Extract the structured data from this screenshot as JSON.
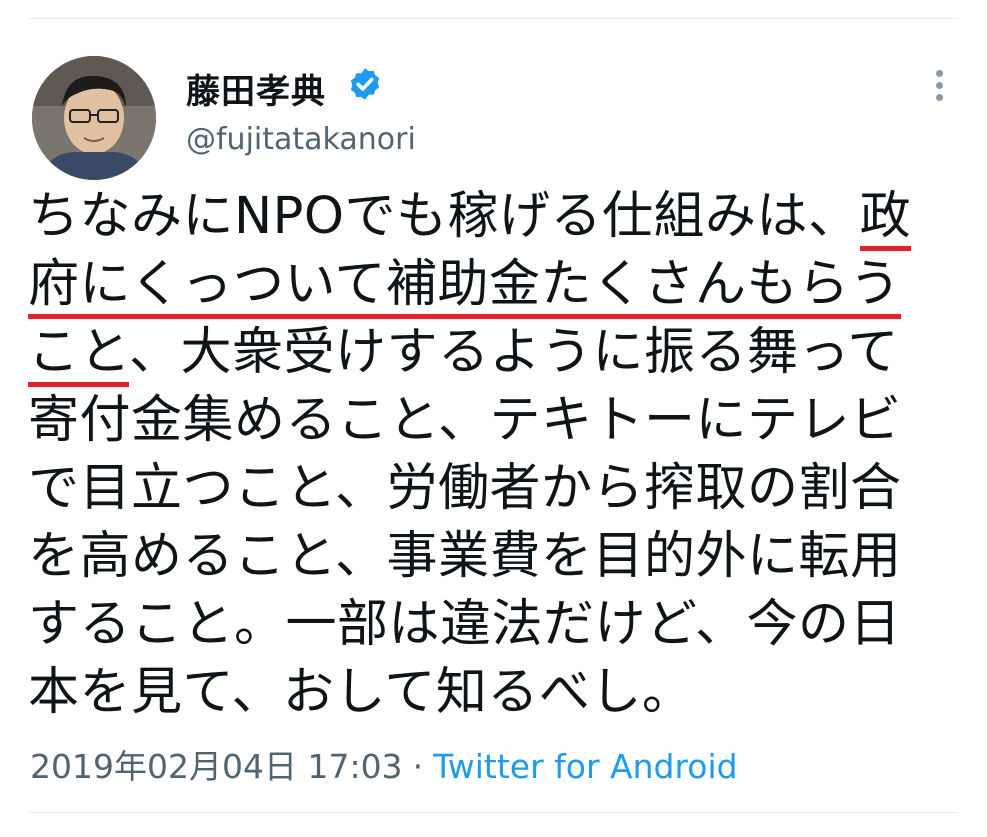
{
  "author": {
    "display_name": "藤田孝典",
    "handle": "@fujitatakanori",
    "verified_icon": "verified-badge-icon"
  },
  "tweet": {
    "lines": [
      {
        "text": "ちなみにNPOでも稼げる仕組みは、",
        "underlined": "政"
      },
      {
        "underlined": "府にくっついて補助金たくさんもらう"
      },
      {
        "underlined": "こと",
        "text": "、大衆受けするように振る舞って"
      },
      {
        "text": "寄付金集めること、テキトーにテレビ"
      },
      {
        "text": "で目立つこと、労働者から搾取の割合"
      },
      {
        "text": "を高めること、事業費を目的外に転用"
      },
      {
        "text": "すること。一部は違法だけど、今の日"
      },
      {
        "text": "本を見て、おして知るべし。"
      }
    ],
    "highlight_color": "#e8202a"
  },
  "meta": {
    "timestamp": "2019年02月04日 17:03",
    "separator": "·",
    "source": "Twitter for Android"
  },
  "colors": {
    "link": "#1d9bf0",
    "secondary_text": "#536471",
    "verified": "#1d9bf0"
  },
  "icons": {
    "more": "more-vertical-icon"
  }
}
